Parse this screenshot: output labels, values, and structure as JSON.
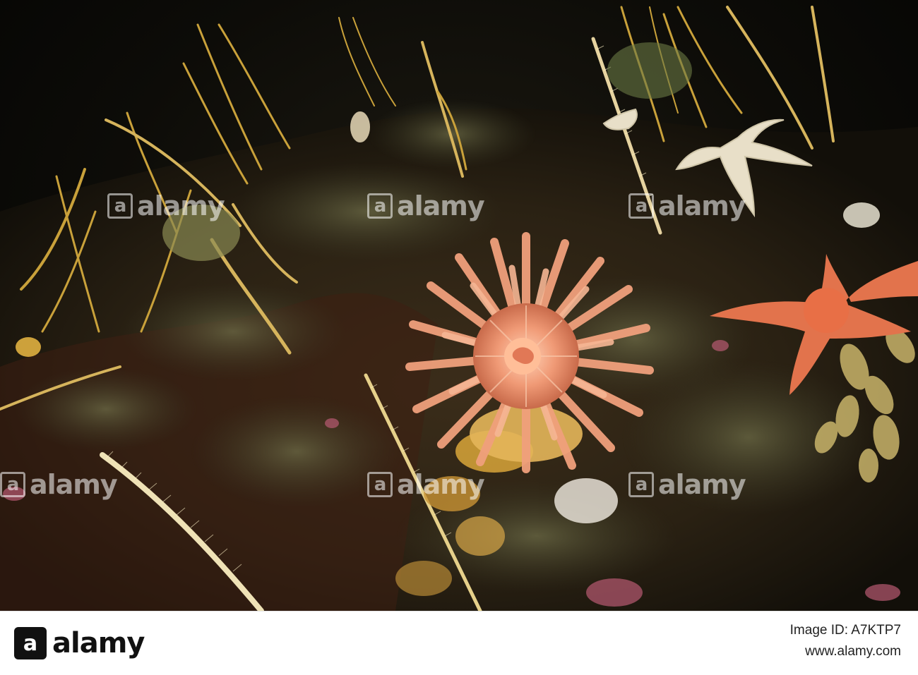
{
  "photo": {
    "subject": "photo",
    "watermark_text": "alamy"
  },
  "footer": {
    "logo_text": "alamy",
    "logo_mark": "a",
    "image_id_label": "Image ID: A7KTP7",
    "site_url": "www.alamy.com"
  },
  "colors": {
    "background": "#0d0c08",
    "anemone": "#f0a07c",
    "starfish": "#e8704a",
    "brittle_star": "#e8dfc8",
    "whip_coral": "#c9a13a",
    "footer_bg": "#ffffff"
  }
}
